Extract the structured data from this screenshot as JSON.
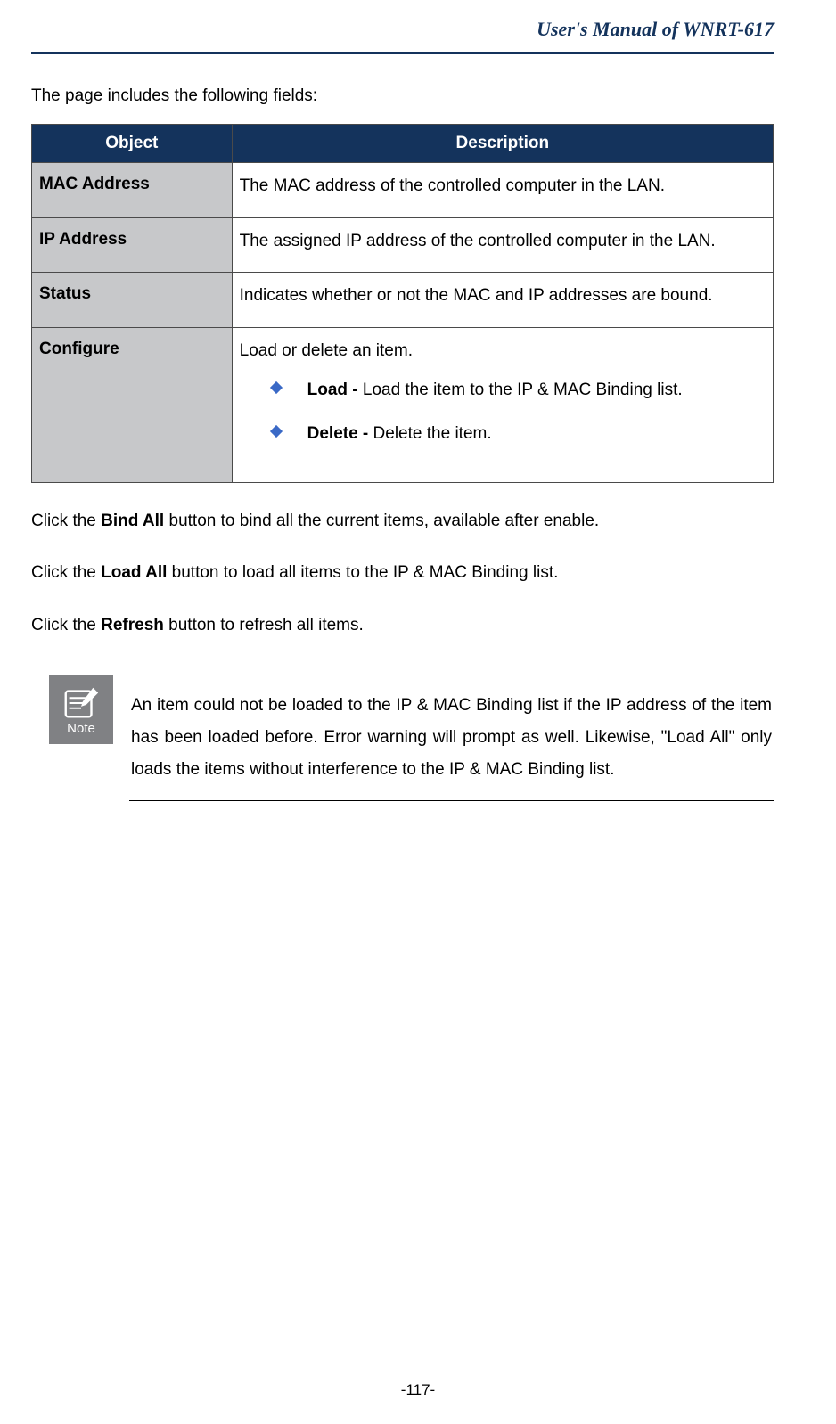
{
  "header": "User's  Manual  of  WNRT-617",
  "intro": "The page includes the following fields:",
  "table": {
    "headers": [
      "Object",
      "Description"
    ],
    "rows": [
      {
        "obj": "MAC Address",
        "desc": "The MAC address of the controlled computer in the LAN."
      },
      {
        "obj": "IP Address",
        "desc": "The assigned IP address of the controlled computer in the LAN."
      },
      {
        "obj": "Status",
        "desc": "Indicates whether or not the MAC and IP addresses are bound."
      },
      {
        "obj": "Configure",
        "desc": "Load or delete an item.",
        "bullets": [
          {
            "bold": "Load - ",
            "rest": "Load the item to the IP & MAC Binding list."
          },
          {
            "bold": "Delete - ",
            "rest": "Delete the item."
          }
        ]
      }
    ]
  },
  "actions": {
    "bind": {
      "pre": "Click the ",
      "bold": "Bind All",
      "post": " button to bind all the current items, available after enable."
    },
    "load": {
      "pre": "Click the ",
      "bold": "Load All",
      "post": " button to load all items to the IP & MAC Binding list."
    },
    "refresh": {
      "pre": "Click the ",
      "bold": "Refresh",
      "post": " button to refresh all items."
    }
  },
  "note": {
    "label": "Note",
    "text": "An item could not be loaded to the IP & MAC Binding list if the IP address of the item has been loaded before. Error warning will prompt as well. Likewise, \"Load All\" only loads the items without interference to the IP & MAC Binding list."
  },
  "pagenum": "-117-"
}
